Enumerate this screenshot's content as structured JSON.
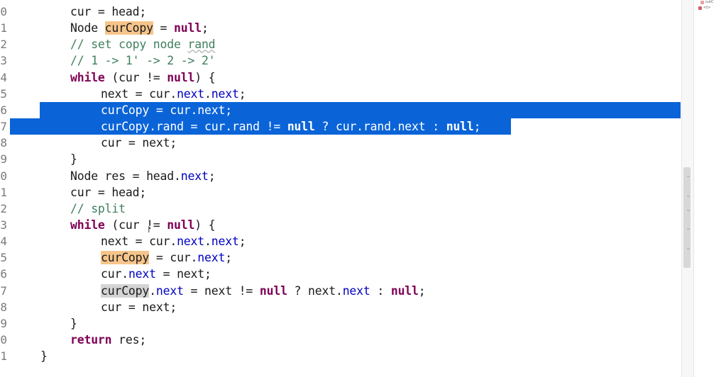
{
  "gutter": {
    "numbers": [
      "0",
      "1",
      "2",
      "3",
      "4",
      "5",
      "6",
      "7",
      "8",
      "9",
      "0",
      "1",
      "2",
      "3",
      "4",
      "5",
      "6",
      "7",
      "8",
      "9",
      "0",
      "1"
    ]
  },
  "code": {
    "lines": [
      [
        {
          "t": "cur = head;",
          "c": "plain"
        }
      ],
      [
        {
          "t": "Node ",
          "c": "plain"
        },
        {
          "t": "curCopy",
          "c": "plain",
          "hl": "orange"
        },
        {
          "t": " = ",
          "c": "plain"
        },
        {
          "t": "null",
          "c": "keyword"
        },
        {
          "t": ";",
          "c": "plain"
        }
      ],
      [
        {
          "t": "// set copy node ",
          "c": "comment"
        },
        {
          "t": "rand",
          "c": "comment",
          "underline": true
        }
      ],
      [
        {
          "t": "// 1 -> 1' -> 2 -> 2'",
          "c": "comment"
        }
      ],
      [
        {
          "t": "while",
          "c": "keyword"
        },
        {
          "t": " (cur != ",
          "c": "plain"
        },
        {
          "t": "null",
          "c": "keyword"
        },
        {
          "t": ") {",
          "c": "plain"
        }
      ],
      [
        {
          "t": "next = cur.",
          "c": "plain"
        },
        {
          "t": "next",
          "c": "field"
        },
        {
          "t": ".",
          "c": "plain"
        },
        {
          "t": "next",
          "c": "field"
        },
        {
          "t": ";",
          "c": "plain"
        }
      ],
      [
        {
          "t": "curCopy = cur.next;",
          "c": "plain"
        }
      ],
      [
        {
          "t": "curCopy.rand = cur.rand != ",
          "c": "plain"
        },
        {
          "t": "null",
          "c": "keyword"
        },
        {
          "t": " ? cur.rand.next : ",
          "c": "plain"
        },
        {
          "t": "null",
          "c": "keyword"
        },
        {
          "t": ";",
          "c": "plain"
        }
      ],
      [
        {
          "t": "cur = next;",
          "c": "plain"
        }
      ],
      [
        {
          "t": "}",
          "c": "plain"
        }
      ],
      [
        {
          "t": "Node res = head.",
          "c": "plain"
        },
        {
          "t": "next",
          "c": "field"
        },
        {
          "t": ";",
          "c": "plain"
        }
      ],
      [
        {
          "t": "cur = head;",
          "c": "plain"
        }
      ],
      [
        {
          "t": "// split",
          "c": "comment"
        }
      ],
      [
        {
          "t": "while",
          "c": "keyword"
        },
        {
          "t": " (cur != ",
          "c": "plain"
        },
        {
          "t": "null",
          "c": "keyword"
        },
        {
          "t": ") {",
          "c": "plain"
        }
      ],
      [
        {
          "t": "next = cur.",
          "c": "plain"
        },
        {
          "t": "next",
          "c": "field"
        },
        {
          "t": ".",
          "c": "plain"
        },
        {
          "t": "next",
          "c": "field"
        },
        {
          "t": ";",
          "c": "plain"
        }
      ],
      [
        {
          "t": "curCopy",
          "c": "plain",
          "hl": "orange"
        },
        {
          "t": " = cur.",
          "c": "plain"
        },
        {
          "t": "next",
          "c": "field"
        },
        {
          "t": ";",
          "c": "plain"
        }
      ],
      [
        {
          "t": "cur.",
          "c": "plain"
        },
        {
          "t": "next",
          "c": "field"
        },
        {
          "t": " = next;",
          "c": "plain"
        }
      ],
      [
        {
          "t": "curCopy",
          "c": "plain",
          "hl": "gray"
        },
        {
          "t": ".",
          "c": "plain"
        },
        {
          "t": "next",
          "c": "field"
        },
        {
          "t": " = next != ",
          "c": "plain"
        },
        {
          "t": "null",
          "c": "keyword"
        },
        {
          "t": " ? next.",
          "c": "plain"
        },
        {
          "t": "next",
          "c": "field"
        },
        {
          "t": " : ",
          "c": "plain"
        },
        {
          "t": "null",
          "c": "keyword"
        },
        {
          "t": ";",
          "c": "plain"
        }
      ],
      [
        {
          "t": "cur = next;",
          "c": "plain"
        }
      ],
      [
        {
          "t": "}",
          "c": "plain"
        }
      ],
      [
        {
          "t": "return",
          "c": "keyword"
        },
        {
          "t": " res;",
          "c": "plain"
        }
      ],
      [
        {
          "t": "}",
          "c": "plain"
        }
      ]
    ],
    "selected_lines": [
      6,
      7
    ]
  },
  "outline": {
    "items": [
      "curC",
      "<t>"
    ]
  },
  "colors": {
    "keyword": "#7f0055",
    "field": "#0000c0",
    "comment": "#3f7f5f",
    "selection": "#0a64d8",
    "occurrence_highlight": "#f6c58b"
  },
  "cursor_icon": "text-cursor-icon"
}
